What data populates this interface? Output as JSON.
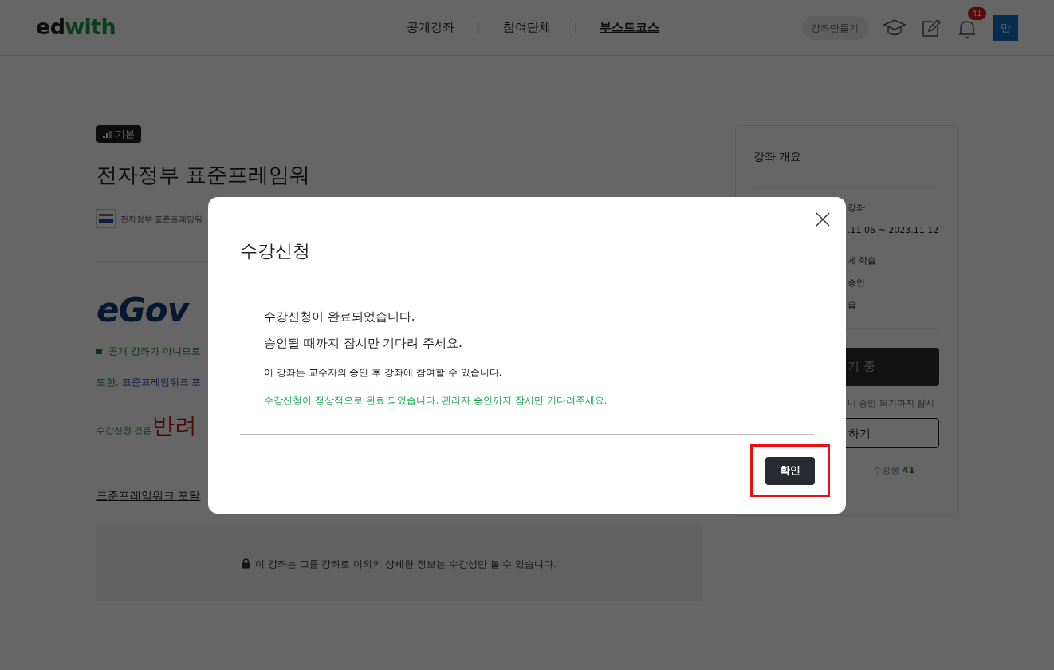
{
  "header": {
    "logo_dark": "ed",
    "logo_green": "with",
    "nav": [
      {
        "label": "공개강좌",
        "selected": false
      },
      {
        "label": "참여단체",
        "selected": false
      },
      {
        "label": "부스트코스",
        "selected": true
      }
    ],
    "create_button": "강좌만들기",
    "notification_count": "41",
    "avatar": "만"
  },
  "course": {
    "level_badge": "기본",
    "title": "전자정부 표준프레임워",
    "org_name": "전자정부 표준프레임워",
    "logo_text": "eGov",
    "notice": "공개 강좌가 아니므로",
    "line_green": "또한, ",
    "line_blue": "표준프레임워크 포",
    "reject_prefix": "수강신청 건은 ",
    "reject_word": "반려",
    "portal_link": "표준프레임워크 포탈",
    "locked_message": "이 강좌는 그룹 강좌로 이외의 상세한 정보는 수강생만 볼 수 있습니다."
  },
  "sidebar": {
    "title": "강좌 개요",
    "rows": [
      "강좌",
      ".11.06 ~ 2023.11.12",
      "게 학습",
      "승인",
      "습"
    ],
    "status_button": "기 중",
    "note": "니 승인 되기까지 잠시",
    "secondary_button": "하기",
    "students_label": "수강생",
    "students_count": "41"
  },
  "dialog": {
    "title": "수강신청",
    "lines": [
      "수강신청이 완료되었습니다.",
      "승인될 때까지 잠시만 기다려 주세요."
    ],
    "info": "이 강좌는 교수자의 승인 후 강좌에 참여할 수 있습니다.",
    "success": "수강신청이 정상적으로 완료 되었습니다. 관리자 승인까지 잠시만 기다려주세요.",
    "confirm_button": "확인",
    "confirm_highlighted": true
  }
}
